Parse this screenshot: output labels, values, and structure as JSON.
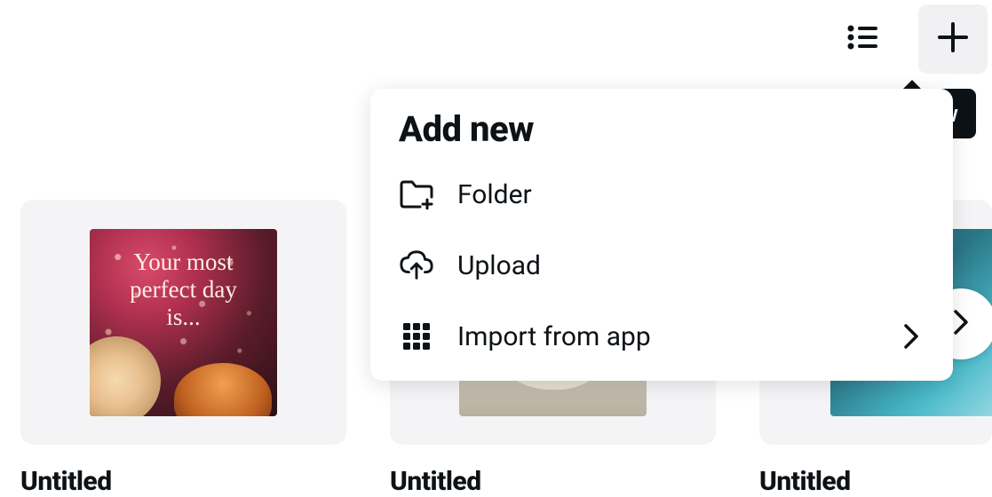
{
  "top_actions": {
    "list_view": "list-view",
    "add": "plus"
  },
  "tooltip": {
    "label": "Add new"
  },
  "dropdown": {
    "title": "Add new",
    "items": [
      {
        "icon": "folder-plus-icon",
        "label": "Folder",
        "has_submenu": false
      },
      {
        "icon": "upload-cloud-icon",
        "label": "Upload",
        "has_submenu": false
      },
      {
        "icon": "apps-grid-icon",
        "label": "Import from app",
        "has_submenu": true
      }
    ]
  },
  "cards": [
    {
      "title": "Untitled",
      "thumb_text": "Your most\nperfect day\nis..."
    },
    {
      "title": "Untitled",
      "thumb_text": ""
    },
    {
      "title": "Untitled",
      "thumb_text": ""
    }
  ]
}
